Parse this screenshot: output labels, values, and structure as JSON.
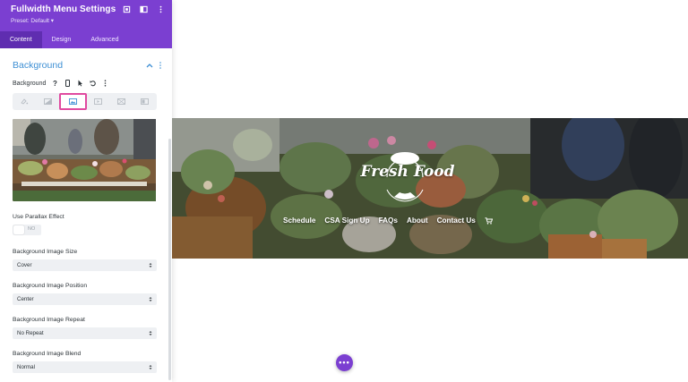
{
  "panel": {
    "title": "Fullwidth Menu Settings",
    "preset": "Preset: Default ▾",
    "header_icons": [
      "expand-icon",
      "sidebar-toggle-icon",
      "more-vertical-icon"
    ],
    "tabs": [
      {
        "label": "Content",
        "active": true
      },
      {
        "label": "Design",
        "active": false
      },
      {
        "label": "Advanced",
        "active": false
      }
    ]
  },
  "background_section": {
    "title": "Background",
    "field_label": "Background",
    "field_tools": [
      "help-icon",
      "mobile-icon",
      "pointer-icon",
      "undo-icon",
      "more-vertical-icon"
    ],
    "types": [
      {
        "icon": "color-icon",
        "active": false
      },
      {
        "icon": "gradient-icon",
        "active": false
      },
      {
        "icon": "image-icon",
        "active": true
      },
      {
        "icon": "video-icon",
        "active": false
      },
      {
        "icon": "pattern-icon",
        "active": false
      },
      {
        "icon": "mask-icon",
        "active": false
      }
    ]
  },
  "fields": {
    "parallax_label": "Use Parallax Effect",
    "parallax_value": "NO",
    "size_label": "Background Image Size",
    "size_value": "Cover",
    "position_label": "Background Image Position",
    "position_value": "Center",
    "repeat_label": "Background Image Repeat",
    "repeat_value": "No Repeat",
    "blend_label": "Background Image Blend",
    "blend_value": "Normal"
  },
  "hero": {
    "logo_text": "Fresh Food",
    "nav": [
      "Schedule",
      "CSA Sign Up",
      "FAQs",
      "About",
      "Contact Us"
    ],
    "cart_icon": "cart-icon"
  },
  "fab_label": "•••",
  "colors": {
    "brand_purple": "#7b3fd1",
    "tab_active": "#5f2db0",
    "section_title": "#3d8fd4",
    "active_highlight": "#e04aa0"
  }
}
